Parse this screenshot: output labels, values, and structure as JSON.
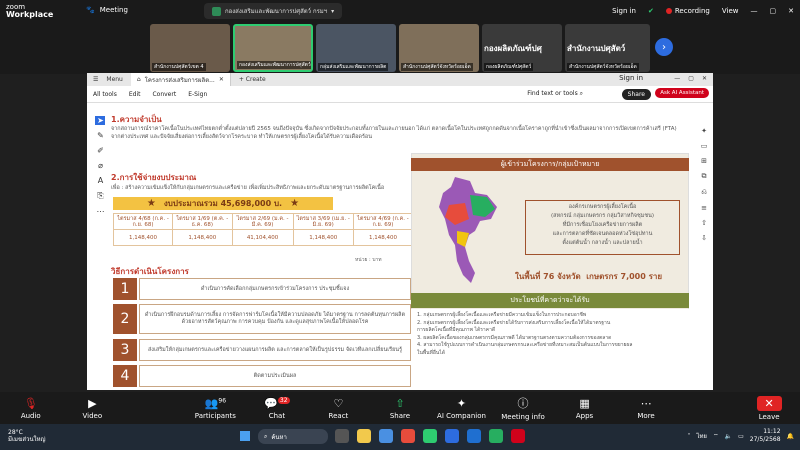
{
  "zoom": {
    "brand_line1": "zoom",
    "brand_line2": "Workplace",
    "meeting_label": "Meeting",
    "meeting_title": "กองส่งเสริมและพัฒนาการปศุสัตว์ กรมฯ",
    "sign_in": "Sign in",
    "recording": "Recording",
    "view": "View",
    "participants_tiles": [
      {
        "label": "สำนักงานปศุสัตว์เขต 4"
      },
      {
        "label": "กองส่งเสริมและพัฒนาการปศุสัตว์"
      },
      {
        "label": "กลุ่มส่งเสริมและพัฒนาการผลิต"
      },
      {
        "label": "สำนักงานปศุสัตว์จังหวัดร้อยเอ็ด"
      },
      {
        "label": "กองผลิตภัณฑ์ปศุสัตว์"
      },
      {
        "label": "สำนักงานปศุสัตว์จังหวัดร้อยเอ็ด"
      }
    ],
    "big_tile_text1": "กองผลิตภัณฑ์ปศุ",
    "big_tile_text2": "สำนักงานปศุสัตว์"
  },
  "acrobat": {
    "tab_menu": "Menu",
    "tab_title": "โครงการส่งเสริมการผลิต...",
    "tab_create": "+ Create",
    "sign_in": "Sign in",
    "menu_items": [
      "All tools",
      "Edit",
      "Convert",
      "E-Sign"
    ],
    "find": "Find text or tools",
    "share": "Share",
    "ask_ai": "Ask AI Assistant"
  },
  "doc": {
    "sec1_title": "1.ความจำเป็น",
    "sec1_text": "จากสถานการณ์ราคาโคเนื้อในประเทศไทยตกต่ำตั้งแต่ปลายปี 2565 จนถึงปัจจุบัน ซึ่งเกิดจากปัจจัยประกอบทั้งภายในและภายนอก ได้แก่ ตลาดเนื้อโคในประเทศถูกกดดันจากเนื้อโคราคาถูกที่นำเข้าซึ่งเป็นผลมาจากการเปิดเขตการค้าเสรี (FTA) จากต่างประเทศ และปัจจัยเสี่ยงต่อการเลี้ยงสัตว์จากโรคระบาด ทำให้เกษตรกรผู้เลี้ยงโคเนื้อได้รับความเดือดร้อน",
    "sec2_title": "2.การใช้จ่ายงบประมาณ",
    "sec2_text": "เพื่อ : สร้างความเข้มแข็งให้กับกลุ่มเกษตรกรและเครือข่าย เพื่อเพิ่มประสิทธิภาพและยกระดับมาตรฐานการผลิตโคเนื้อ",
    "budget_total": "งบประมาณรวม 45,698,000 บ.",
    "budget_table": {
      "periods": [
        "ไตรมาส 4/68\n(ก.ค. - ก.ย. 68)",
        "ไตรมาส 1/69\n(ต.ค. - ธ.ค. 68)",
        "ไตรมาส 2/69\n(ม.ค. - มี.ค. 69)",
        "ไตรมาส 3/69\n(เม.ย. - มิ.ย. 69)",
        "ไตรมาส 4/69\n(ก.ค. - ก.ย. 69)"
      ],
      "amounts": [
        "1,148,400",
        "1,148,400",
        "41,104,400",
        "1,148,400",
        "1,148,400"
      ]
    },
    "unit": "หน่วย : บาท",
    "sec3_title": "วิธีการดำเนินโครงการ",
    "steps": [
      {
        "num": "1",
        "text": "ดำเนินการคัดเลือกกลุ่มเกษตรกรเข้าร่วมโครงการ ประชุมชี้แจง"
      },
      {
        "num": "2",
        "text": "ดำเนินการฝึกอบรมด้านการเลี้ยง การจัดการฟาร์มโคเนื้อให้มีความปลอดภัย ได้มาตรฐาน การลดต้นทุนการผลิตด้วยอาหารสัตว์คุณภาพ การควบคุม ป้องกัน และดูแลสุขภาพโคเนื้อให้ปลอดโรค"
      },
      {
        "num": "3",
        "text": "ส่งเสริมให้กลุ่มเกษตรกรและเครือข่ายวางแผนการผลิต และการตลาดให้เป็นรูปธรรม จัดเวทีแลกเปลี่ยนเรียนรู้"
      },
      {
        "num": "4",
        "text": "ติดตามประเมินผล"
      }
    ],
    "participants_head": "ผู้เข้าร่วมโครงการ/กลุ่มเป้าหมาย",
    "group_box": [
      "องค์กรเกษตรกรผู้เลี้ยงโคเนื้อ",
      "(สหกรณ์ กลุ่มเกษตรกร กลุ่มวิสาหกิจชุมชน)",
      "ที่มีการเชื่อมโยงเครือข่ายการผลิต",
      "และการตลาดที่ชัดเจนตลอดห่วงโซ่อุปทาน",
      "ตั้งแต่ต้นน้ำ กลางน้ำ และปลายน้ำ"
    ],
    "provinces": "ในพื้นที่ 76 จังหวัด",
    "farmers": "เกษตรกร 7,000 ราย",
    "benefits_head": "ประโยชน์ที่คาดว่าจะได้รับ",
    "benefits": [
      "1. กลุ่มเกษตรกรผู้เลี้ยงโคเนื้อและเครือข่ายมีความเข้มแข็งในการประกอบอาชีพ",
      "2. กลุ่มเกษตรกรผู้เลี้ยงโคเนื้อและเครือข่ายได้รับการส่งเสริมการเลี้ยงโคเนื้อให้ได้มาตรฐาน",
      "   การผลิตโคเนื้อที่มีคุณภาพ ได้ราคาดี",
      "3. ผลผลิตโคเนื้อของกลุ่มเกษตรกรมีคุณภาพดี ได้มาตรฐานตรงตามความต้องการของตลาด",
      "4. สามารถใช้รูปแบบการดำเนินงานกลุ่มเกษตรกรและเครือข่ายที่เหมาะสมเป็นต้นแบบในการขยายผล",
      "   ในพื้นที่อื่นได้"
    ]
  },
  "toolbar": {
    "audio": "Audio",
    "video": "Video",
    "participants": "Participants",
    "participants_count": "96",
    "chat": "Chat",
    "chat_badge": "32",
    "react": "React",
    "share": "Share",
    "ai_companion": "AI Companion",
    "meeting_info": "Meeting info",
    "apps": "Apps",
    "more": "More",
    "leave": "Leave"
  },
  "taskbar": {
    "temp": "28°C",
    "weather": "มีเมฆส่วนใหญ่",
    "search": "ค้นหา",
    "lang": "ไทย",
    "time": "11:12",
    "date": "27/5/2568"
  }
}
